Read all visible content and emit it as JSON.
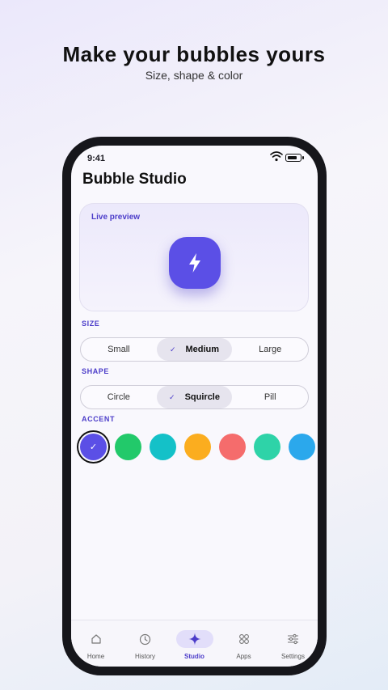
{
  "headline": "Make your bubbles yours",
  "subline": "Size, shape & color",
  "status": {
    "time": "9:41"
  },
  "app": {
    "title": "Bubble Studio"
  },
  "preview": {
    "label": "Live preview",
    "bubble_color": "#5b4fe6",
    "icon": "lightning-bolt-icon"
  },
  "size": {
    "label": "SIZE",
    "options": [
      "Small",
      "Medium",
      "Large"
    ],
    "selected": "Medium"
  },
  "shape": {
    "label": "SHAPE",
    "options": [
      "Circle",
      "Squircle",
      "Pill"
    ],
    "selected": "Squircle"
  },
  "accent": {
    "label": "ACCENT",
    "colors": [
      "#5b4fe6",
      "#22c96a",
      "#14c1c8",
      "#fbad1f",
      "#f56c6c",
      "#2ed3a8",
      "#2ba8ec"
    ],
    "selected_index": 0
  },
  "tabs": [
    {
      "label": "Home",
      "icon": "home-icon"
    },
    {
      "label": "History",
      "icon": "clock-icon"
    },
    {
      "label": "Studio",
      "icon": "sparkle-icon"
    },
    {
      "label": "Apps",
      "icon": "apps-grid-icon"
    },
    {
      "label": "Settings",
      "icon": "sliders-icon"
    }
  ],
  "active_tab": "Studio"
}
